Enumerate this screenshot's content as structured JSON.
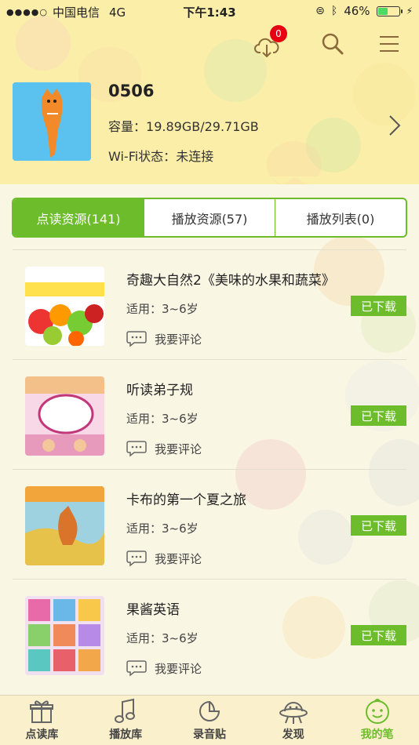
{
  "status_bar": {
    "carrier": "中国电信",
    "network": "4G",
    "time": "下午1:43",
    "battery": "46%",
    "battery_level": 0.46
  },
  "header": {
    "download_badge": "0",
    "device": {
      "name": "0506",
      "capacity_label": "容量：",
      "capacity_value": "19.89GB/29.71GB",
      "wifi_label": "Wi-Fi状态：",
      "wifi_value": "未连接"
    }
  },
  "tabs": [
    {
      "label": "点读资源(141)",
      "active": true
    },
    {
      "label": "播放资源(57)",
      "active": false
    },
    {
      "label": "播放列表(0)",
      "active": false
    }
  ],
  "list": [
    {
      "title": "奇趣大自然2《美味的水果和蔬菜》",
      "age_label": "适用：",
      "age_value": "3~6岁",
      "status": "已下载",
      "comment": "我要评论"
    },
    {
      "title": "听读弟子规",
      "age_label": "适用：",
      "age_value": "3~6岁",
      "status": "已下载",
      "comment": "我要评论"
    },
    {
      "title": "卡布的第一个夏之旅",
      "age_label": "适用：",
      "age_value": "3~6岁",
      "status": "已下载",
      "comment": "我要评论"
    },
    {
      "title": "果酱英语",
      "age_label": "适用：",
      "age_value": "3~6岁",
      "status": "已下载",
      "comment": "我要评论"
    }
  ],
  "tabbar": [
    {
      "label": "点读库",
      "icon": "gift-icon",
      "active": false
    },
    {
      "label": "播放库",
      "icon": "music-note-icon",
      "active": false
    },
    {
      "label": "录音贴",
      "icon": "sticker-icon",
      "active": false
    },
    {
      "label": "发现",
      "icon": "ufo-icon",
      "active": false
    },
    {
      "label": "我的笔",
      "icon": "smiley-face-icon",
      "active": true
    }
  ],
  "colors": {
    "accent_green": "#6cbc2c",
    "header_yellow": "#fbeea9",
    "badge_red": "#e60012"
  }
}
